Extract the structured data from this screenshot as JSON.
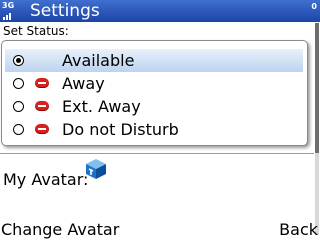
{
  "status_bar": {
    "network_label": "3G",
    "title": "Settings",
    "counter": "0"
  },
  "section_label": "Set Status:",
  "status_options": [
    {
      "label": "Available",
      "selected": true,
      "icon": "none"
    },
    {
      "label": "Away",
      "selected": false,
      "icon": "away-status-icon"
    },
    {
      "label": "Ext. Away",
      "selected": false,
      "icon": "extended-away-status-icon"
    },
    {
      "label": "Do not Disturb",
      "selected": false,
      "icon": "do-not-disturb-status-icon"
    }
  ],
  "avatar": {
    "label": "My Avatar:",
    "icon": "blue-cube-avatar-icon"
  },
  "softkeys": {
    "left": "Change Avatar",
    "right": "Back"
  },
  "colors": {
    "title_bar": "#2c56ba",
    "selection_highlight": "#bcd3f0",
    "status_icon": "#d82020",
    "avatar": "#1e73c8"
  }
}
